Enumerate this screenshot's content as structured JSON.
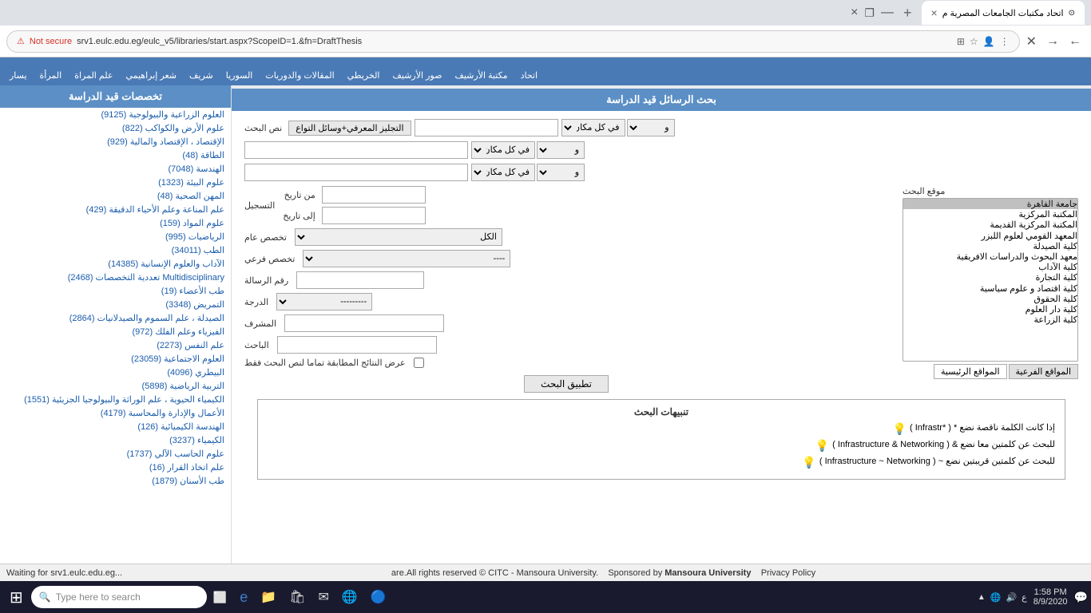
{
  "browser": {
    "tab_title": "اتحاد مكتبات الجامعات المصرية م",
    "url": "srv1.eulc.edu.eg/eulc_v5/libraries/start.aspx?ScopeID=1.&fn=DraftThesis",
    "not_secure": "Not secure",
    "status": "Waiting for srv1.eulc.edu.eg..."
  },
  "nav_menu": {
    "items": [
      "يسار",
      "المرأة",
      "علم المراة",
      "شعر إبراهيمي",
      "شريف",
      "السوريا",
      "المقالات والدوريات",
      "الخريطي",
      "صور الأرشيف",
      "مكتبة الأرشيف",
      "اتحاد"
    ]
  },
  "search": {
    "header": "بحث الرسائل قيد الدراسة",
    "text_label": "نص البحث",
    "search_type": "التجليز المعرفي+وسائل التواع",
    "location_label": "موقع البحث",
    "field_options_1": [
      "في كل مكان"
    ],
    "field_options_2": [
      "في كل مكان"
    ],
    "field_options_3": [
      "في كل مكان"
    ],
    "registration_label": "التسجيل",
    "from_date_label": "من تاريخ",
    "to_date_label": "إلى تاريخ",
    "specialty_label": "تخصص عام",
    "specialty_default": "الكل",
    "subspecialty_label": "تخصص فرعي",
    "subspecialty_default": "----",
    "thesis_number_label": "رقم الرسالة",
    "degree_label": "الدرجة",
    "degree_default": "---------",
    "supervisor_label": "المشرف",
    "researcher_label": "الباحث",
    "exact_match_label": "عرض النتائج المطابقة تماما لنص البحث فقط",
    "search_btn": "تطبيق البحث",
    "location_items": [
      "جامعة القاهرة",
      "المكتبة المركزية",
      "المكتبة المركزية القديمة",
      "المعهد القومي لعلوم اللبزر",
      "كلية الصيدلة",
      "معهد البحوث والدراسات الافريقية",
      "كلية الآداب",
      "كلية التجارة",
      "كلية اقتصاد و علوم سياسية",
      "كلية الحقوق",
      "كلية دار العلوم",
      "كلية الزراعة"
    ],
    "main_locations_tab": "المواقع الرئيسية",
    "sub_locations_tab": "المواقع الفرعية",
    "tips_header": "تنبيهات البحث",
    "tips": [
      "إذا كانت الكلمة ناقصة نضع * ( *Infrastr )",
      "للبحث عن كلمتين معا نضع & ( Infrastructure & Networking )",
      "للبحث عن كلمتين قريبتين نضع ~ ( Infrastructure ~ Networking )"
    ]
  },
  "sidebar": {
    "header": "تخصصات قيد الدراسة",
    "items": [
      {
        "label": "العلوم الزراعية والبيولوجية",
        "count": "(9125)"
      },
      {
        "label": "علوم الأرض والكواكب",
        "count": "(822)"
      },
      {
        "label": "الإقتصاد ، الإقتصاد والمالية",
        "count": "(929)"
      },
      {
        "label": "الطاقة",
        "count": "(48)"
      },
      {
        "label": "الهندسة",
        "count": "(7048)"
      },
      {
        "label": "علوم البيئة",
        "count": "(1323)"
      },
      {
        "label": "المهن الصحية",
        "count": "(48)"
      },
      {
        "label": "علم المناعة وعلم الأحياء الدقيقة",
        "count": "(429)"
      },
      {
        "label": "علوم المواد",
        "count": "(159)"
      },
      {
        "label": "الرياضيات",
        "count": "(995)"
      },
      {
        "label": "الطب",
        "count": "(34011)"
      },
      {
        "label": "الآداب والعلوم الإنسانية",
        "count": "(14385)"
      },
      {
        "label": "Multidisciplinary تعددية التخصصات",
        "count": "(2468)"
      },
      {
        "label": "طب الأعضاء",
        "count": "(19)"
      },
      {
        "label": "التمريض",
        "count": "(3348)"
      },
      {
        "label": "الصيدلة ، علم السموم والصيدلانيات",
        "count": "(2864)"
      },
      {
        "label": "الفيزياء وعلم الفلك",
        "count": "(972)"
      },
      {
        "label": "علم النفس",
        "count": "(2273)"
      },
      {
        "label": "العلوم الاجتماعية",
        "count": "(23059)"
      },
      {
        "label": "البيطري",
        "count": "(4096)"
      },
      {
        "label": "التربية الرياضية",
        "count": "(5898)"
      },
      {
        "label": "الكيمياء الحيوية ، علم الوراثة والبيولوجيا الجزيئية",
        "count": "(1551)"
      },
      {
        "label": "الأعمال والإدارة والمحاسبة",
        "count": "(4179)"
      },
      {
        "label": "الهندسة الكيميائية",
        "count": "(126)"
      },
      {
        "label": "الكيمياء",
        "count": "(3237)"
      },
      {
        "label": "علوم الحاسب الآلي",
        "count": "(1737)"
      },
      {
        "label": "علم اتخاذ القرار",
        "count": "(16)"
      },
      {
        "label": "طب الأسنان",
        "count": "(1879)"
      }
    ]
  },
  "footer": {
    "rights": "are.All rights reserved © CITC",
    "sponsor": "Sponsored by",
    "sponsor_name": "Mansoura University",
    "privacy": "Privacy Policy",
    "mansoura": "- Mansoura University."
  },
  "taskbar": {
    "search_placeholder": "Type here to search",
    "time": "1:58 PM",
    "date": "8/9/2020"
  }
}
